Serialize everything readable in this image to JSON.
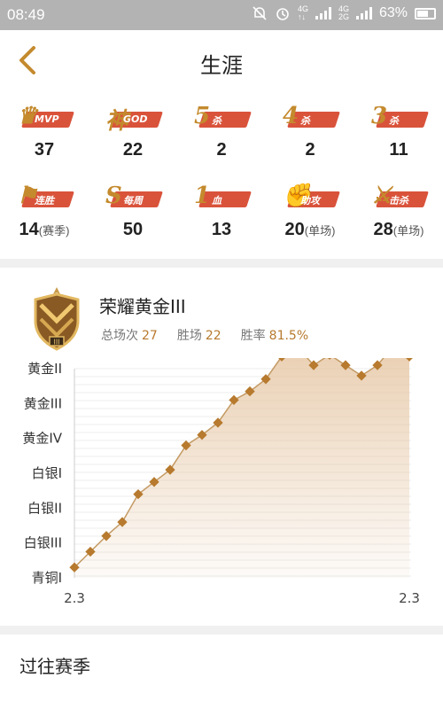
{
  "statusbar": {
    "time": "08:49",
    "net1": "4G",
    "net2": "4G",
    "net3": "2G",
    "battery": "63%"
  },
  "header": {
    "title": "生涯"
  },
  "stats": [
    {
      "badge": "MVP",
      "icon": "trophy-icon",
      "value": "37",
      "suffix": ""
    },
    {
      "badge": "GOD",
      "icon": "god-icon",
      "value": "22",
      "suffix": ""
    },
    {
      "badge": "杀",
      "icon": "penta-kill-icon",
      "big": "5",
      "value": "2",
      "suffix": ""
    },
    {
      "badge": "杀",
      "icon": "quadra-kill-icon",
      "big": "4",
      "value": "2",
      "suffix": ""
    },
    {
      "badge": "杀",
      "icon": "triple-kill-icon",
      "big": "3",
      "value": "11",
      "suffix": ""
    },
    {
      "badge": "连胜",
      "icon": "win-streak-flag-icon",
      "value": "14",
      "suffix": "(赛季)"
    },
    {
      "badge": "每周",
      "icon": "weekly-s-icon",
      "big": "S",
      "value": "50",
      "suffix": ""
    },
    {
      "badge": "血",
      "icon": "first-blood-icon",
      "big": "1",
      "value": "13",
      "suffix": ""
    },
    {
      "badge": "助攻",
      "icon": "assist-fist-icon",
      "value": "20",
      "suffix": "(单场)"
    },
    {
      "badge": "击杀",
      "icon": "kill-sword-icon",
      "value": "28",
      "suffix": "(单场)"
    }
  ],
  "rank": {
    "title": "荣耀黄金III",
    "total_label": "总场次",
    "total": "27",
    "wins_label": "胜场",
    "wins": "22",
    "winrate_label": "胜率",
    "winrate": "81.5%",
    "colors": {
      "accent": "#b77a2e",
      "line": "#c49a63",
      "fill": "#e6c7a5"
    }
  },
  "chart_data": {
    "type": "area",
    "y_categories": [
      "青铜I",
      "白银III",
      "白银II",
      "白银I",
      "黄金IV",
      "黄金III",
      "黄金II"
    ],
    "x_tick_labels": [
      "2.3",
      "2.3"
    ],
    "values": [
      0.3,
      0.75,
      1.2,
      1.6,
      2.4,
      2.75,
      3.1,
      3.8,
      4.1,
      4.45,
      5.1,
      5.35,
      5.7,
      6.35,
      6.62,
      6.1,
      6.4,
      6.1,
      5.8,
      6.1,
      6.65,
      6.35
    ]
  },
  "past": {
    "title": "过往赛季"
  }
}
